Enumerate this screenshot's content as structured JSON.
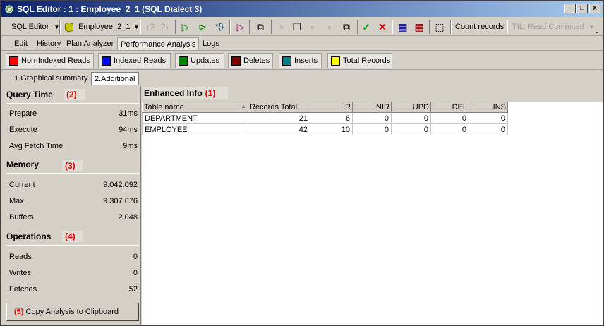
{
  "window": {
    "title": "SQL Editor : 1 : Employee_2_1 (SQL Dialect 3)",
    "controls": [
      "_",
      "□",
      "x"
    ]
  },
  "toolbar": {
    "sql_editor_label": "SQL Editor",
    "database_label": "Employee_2_1",
    "count_records_label": "Count records",
    "til_label": "TIL: Read Commited"
  },
  "menu_tabs": [
    "Edit",
    "History",
    "Plan Analyzer",
    "Performance Analysis",
    "Logs"
  ],
  "legend": [
    {
      "label": "Non-Indexed Reads",
      "color": "#ff0000"
    },
    {
      "label": "Indexed Reads",
      "color": "#0000ff"
    },
    {
      "label": "Updates",
      "color": "#008000"
    },
    {
      "label": "Deletes",
      "color": "#800000"
    },
    {
      "label": "Inserts",
      "color": "#008080"
    },
    {
      "label": "Total Records",
      "color": "#ffff00"
    }
  ],
  "sub_tabs": [
    "1.Graphical summary",
    "2.Additional"
  ],
  "query_time": {
    "title": "Query Time",
    "num": "(2)",
    "rows": [
      {
        "label": "Prepare",
        "value": "31ms"
      },
      {
        "label": "Execute",
        "value": "94ms"
      },
      {
        "label": "Avg Fetch Time",
        "value": "9ms"
      }
    ]
  },
  "memory": {
    "title": "Memory",
    "num": "(3)",
    "rows": [
      {
        "label": "Current",
        "value": "9.042.092"
      },
      {
        "label": "Max",
        "value": "9.307.676"
      },
      {
        "label": "Buffers",
        "value": "2.048"
      }
    ]
  },
  "operations": {
    "title": "Operations",
    "num": "(4)",
    "rows": [
      {
        "label": "Reads",
        "value": "0"
      },
      {
        "label": "Writes",
        "value": "0"
      },
      {
        "label": "Fetches",
        "value": "52"
      }
    ]
  },
  "copy_button": {
    "num": "(5)",
    "label": "Copy Analysis to Clipboard"
  },
  "enhanced_info": {
    "title": "Enhanced Info",
    "num": "(1)",
    "columns": [
      "Table name",
      "Records Total",
      "IR",
      "NIR",
      "UPD",
      "DEL",
      "INS"
    ],
    "rows": [
      [
        "DEPARTMENT",
        "21",
        "6",
        "0",
        "0",
        "0",
        "0"
      ],
      [
        "EMPLOYEE",
        "42",
        "10",
        "0",
        "0",
        "0",
        "0"
      ]
    ]
  }
}
